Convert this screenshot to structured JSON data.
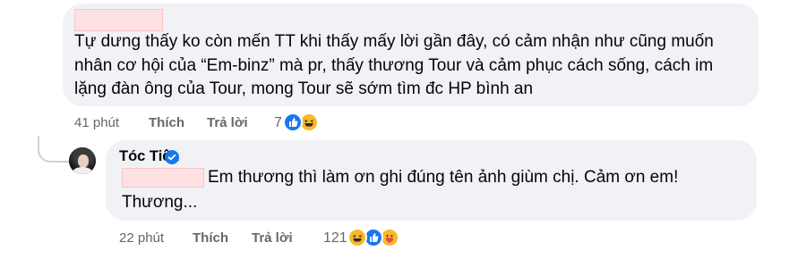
{
  "comments": [
    {
      "author": "",
      "text": "Tự dưng thấy ko còn mến TT khi thấy mấy lời gần đây, có cảm nhận như cũng muốn nhân cơ hội của “Em-binz” mà pr, thấy thương Tour và cảm phục cách sống, cách im lặng đàn ông của Tour, mong Tour sẽ sớm tìm đc HP bình an",
      "time": "41 phút",
      "like_label": "Thích",
      "reply_label": "Trả lời",
      "reaction_count": "7",
      "reaction_icons": [
        "like-icon",
        "haha-icon"
      ]
    },
    {
      "author": "Tóc Tiên",
      "verified": true,
      "text_line1": "Em thương thì làm ơn ghi đúng tên ảnh giùm chị. Cảm ơn em!",
      "text_line2": "Thương...",
      "time": "22 phút",
      "like_label": "Thích",
      "reply_label": "Trả lời",
      "reaction_count": "121",
      "reaction_icons": [
        "haha-icon",
        "like-icon",
        "care-icon"
      ]
    }
  ],
  "colors": {
    "bubble": "#f0f2f5",
    "meta_text": "#65676b",
    "like_blue": "#1877f2",
    "haha_yellow": "#f7b928",
    "verified_blue": "#1877f2",
    "redaction": "#fde1e3"
  }
}
